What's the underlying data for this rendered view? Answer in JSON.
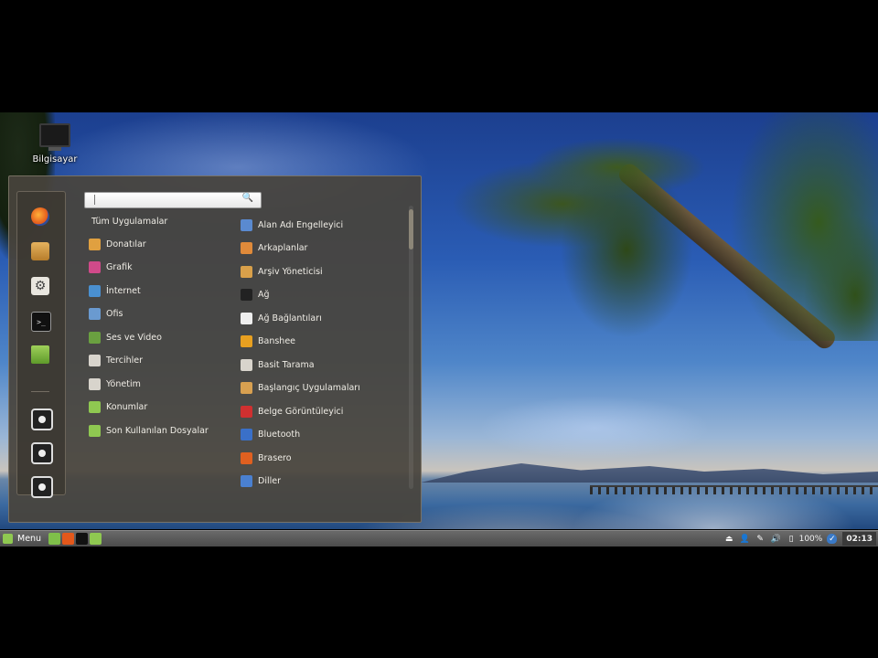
{
  "desktop": {
    "icon": {
      "label": "Bilgisayar",
      "icon": "computer-icon"
    }
  },
  "menu": {
    "search": {
      "placeholder": ""
    },
    "favorites": [
      {
        "name": "firefox",
        "icon": "firefox-icon"
      },
      {
        "name": "archive-manager",
        "icon": "archive-icon"
      },
      {
        "name": "system-settings",
        "icon": "settings-icon"
      },
      {
        "name": "terminal",
        "icon": "terminal-icon"
      },
      {
        "name": "files",
        "icon": "folder-icon"
      },
      {
        "name": "lock",
        "icon": "power-icon"
      },
      {
        "name": "logout",
        "icon": "power-icon"
      },
      {
        "name": "shutdown",
        "icon": "power-icon"
      }
    ],
    "all_apps_label": "Tüm Uygulamalar",
    "categories": [
      {
        "label": "Donatılar",
        "icon": "accessories-icon",
        "color": "#e0a040"
      },
      {
        "label": "Grafik",
        "icon": "graphics-icon",
        "color": "#d04a8a"
      },
      {
        "label": "İnternet",
        "icon": "internet-icon",
        "color": "#4a90d0"
      },
      {
        "label": "Ofis",
        "icon": "office-icon",
        "color": "#6a9ad0"
      },
      {
        "label": "Ses ve Video",
        "icon": "multimedia-icon",
        "color": "#6aa040"
      },
      {
        "label": "Tercihler",
        "icon": "preferences-icon",
        "color": "#d8d4cc"
      },
      {
        "label": "Yönetim",
        "icon": "administration-icon",
        "color": "#d8d4cc"
      },
      {
        "label": "Konumlar",
        "icon": "places-folder-icon",
        "color": "#8fc851"
      },
      {
        "label": "Son Kullanılan Dosyalar",
        "icon": "recent-folder-icon",
        "color": "#8fc851"
      }
    ],
    "apps": [
      {
        "label": "Alan Adı Engelleyici",
        "icon": "domain-blocker-icon",
        "color": "#5a8ad0"
      },
      {
        "label": "Arkaplanlar",
        "icon": "backgrounds-icon",
        "color": "#e08a3a"
      },
      {
        "label": "Arşiv Yöneticisi",
        "icon": "archive-manager-icon",
        "color": "#d9a04a"
      },
      {
        "label": "Ağ",
        "icon": "network-icon",
        "color": "#222222"
      },
      {
        "label": "Ağ Bağlantıları",
        "icon": "network-connections-icon",
        "color": "#eeeeee"
      },
      {
        "label": "Banshee",
        "icon": "banshee-icon",
        "color": "#e8a020"
      },
      {
        "label": "Basit Tarama",
        "icon": "scanner-icon",
        "color": "#d8d4cc"
      },
      {
        "label": "Başlangıç Uygulamaları",
        "icon": "startup-apps-icon",
        "color": "#d8a050"
      },
      {
        "label": "Belge Görüntüleyici",
        "icon": "document-viewer-icon",
        "color": "#d03030"
      },
      {
        "label": "Bluetooth",
        "icon": "bluetooth-icon",
        "color": "#3a70c8"
      },
      {
        "label": "Brasero",
        "icon": "brasero-icon",
        "color": "#e06020"
      },
      {
        "label": "Diller",
        "icon": "languages-icon",
        "color": "#4a80d0"
      }
    ]
  },
  "taskbar": {
    "menu_label": "Menu",
    "launchers": [
      {
        "name": "show-desktop",
        "icon": "desktop-icon",
        "color": "#7fbf4a"
      },
      {
        "name": "firefox",
        "icon": "firefox-icon",
        "color": "#e3581b"
      },
      {
        "name": "terminal",
        "icon": "terminal-icon",
        "color": "#111111"
      },
      {
        "name": "files",
        "icon": "folder-icon",
        "color": "#8fc851"
      }
    ],
    "tray": {
      "battery": "100%",
      "clock": "02:13"
    }
  }
}
